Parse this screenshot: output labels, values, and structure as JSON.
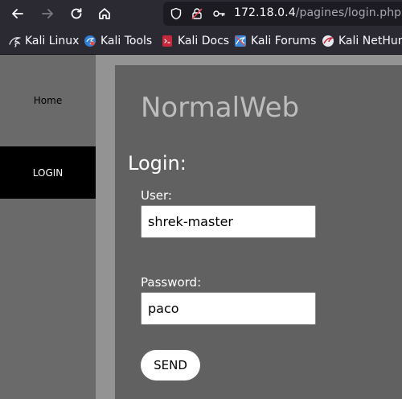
{
  "browser": {
    "url_host": "172.18.0.4",
    "url_path": "/pagines/login.php",
    "bookmarks": [
      {
        "label": "Kali Linux",
        "icon": "kali-dragon-icon"
      },
      {
        "label": "Kali Tools",
        "icon": "kali-tools-icon"
      },
      {
        "label": "Kali Docs",
        "icon": "kali-docs-icon"
      },
      {
        "label": "Kali Forums",
        "icon": "kali-forums-icon"
      },
      {
        "label": "Kali NetHunter",
        "icon": "kali-nethunter-icon"
      }
    ]
  },
  "sidebar": {
    "items": [
      {
        "label": "Home"
      },
      {
        "label": "LOGIN"
      }
    ]
  },
  "main": {
    "site_title": "NormalWeb",
    "form_heading": "Login:",
    "user_label": "User:",
    "user_value": "shrek-master",
    "password_label": "Password:",
    "password_value": "paco",
    "send_label": "SEND"
  },
  "colors": {
    "chrome": "#2b2a33",
    "urlbar": "#1c1b22",
    "sidebar": "#6a6a6a",
    "sidebar_active": "#000000",
    "content": "#616161",
    "title": "#bdbdbd"
  }
}
